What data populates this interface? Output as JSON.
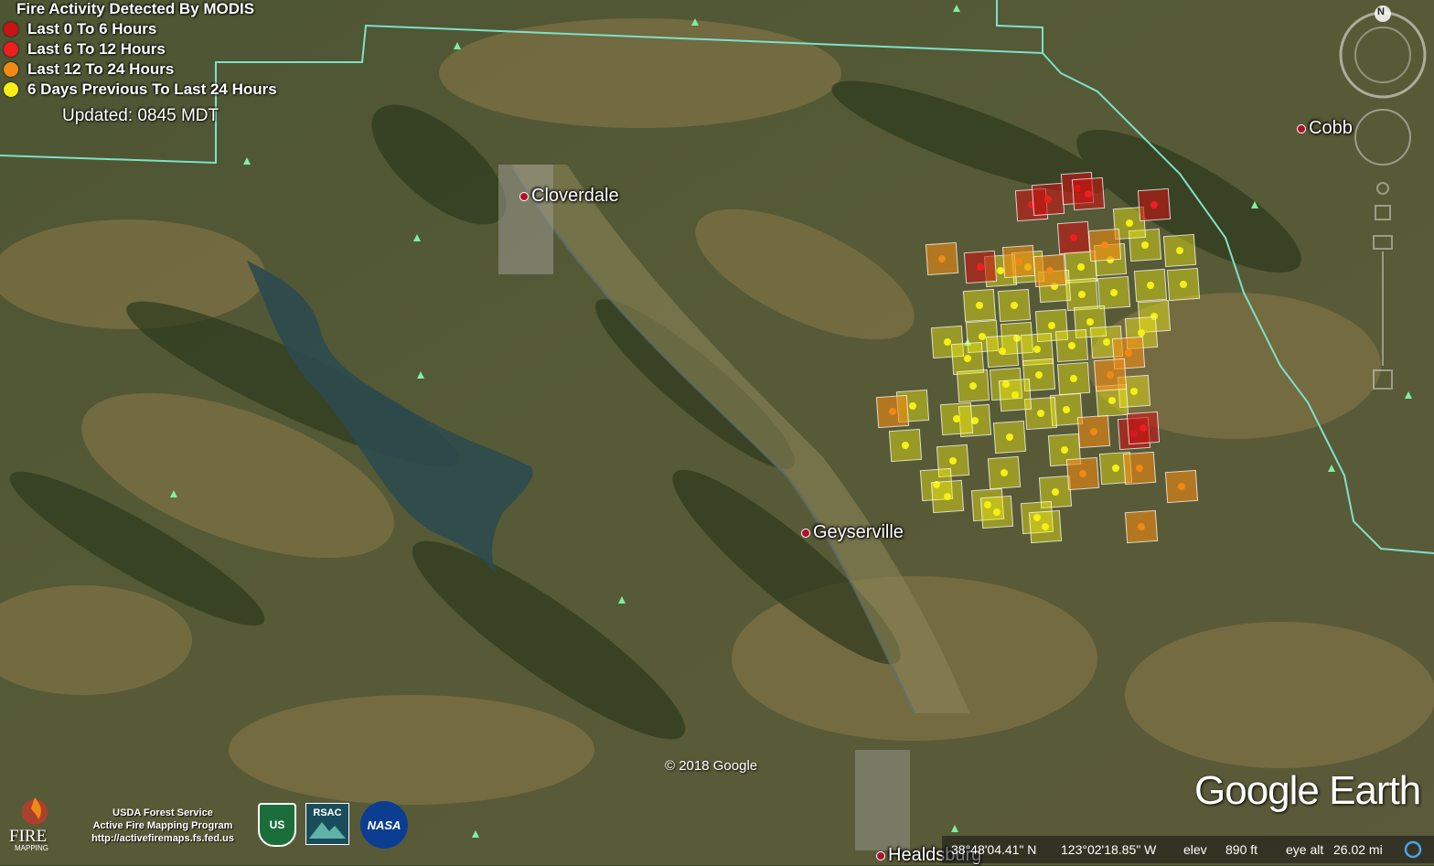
{
  "legend": {
    "title": "Fire Activity Detected By MODIS",
    "items": [
      {
        "label": "Last 0 To 6 Hours",
        "color": "#c81414"
      },
      {
        "label": "Last 6 To 12 Hours",
        "color": "#f01e1e"
      },
      {
        "label": "Last 12 To 24 Hours",
        "color": "#f08a14"
      },
      {
        "label": "6 Days Previous To Last 24 Hours",
        "color": "#f5f014"
      }
    ],
    "updated": "Updated: 0845 MDT"
  },
  "places": {
    "cloverdale": "Cloverdale",
    "geyserville": "Geyserville",
    "cobb": "Cobb",
    "healdsburg": "Healdsburg"
  },
  "copyright": "© 2018 Google",
  "brand": "Google Earth",
  "status": {
    "lat": "38°48'04.41\" N",
    "lon": "123°02'18.85\" W",
    "elev_label": "elev",
    "elev_value": "890 ft",
    "eye_label": "eye alt",
    "eye_value": "26.02 mi"
  },
  "credits": {
    "line1": "USDA Forest Service",
    "line2": "Active Fire Mapping Program",
    "line3": "http://activefiremaps.fs.fed.us",
    "fire_logo": "FIRE",
    "fire_logo_sub": "MAPPING",
    "rsac": "RSAC",
    "nasa": "NASA",
    "usda_badge": "US"
  },
  "compass": {
    "north": "N"
  },
  "colors": {
    "red_dark": "#c81414",
    "red": "#f01e1e",
    "orange": "#f08a14",
    "yellow": "#f5f014",
    "county_line": "#7fe0c8"
  }
}
